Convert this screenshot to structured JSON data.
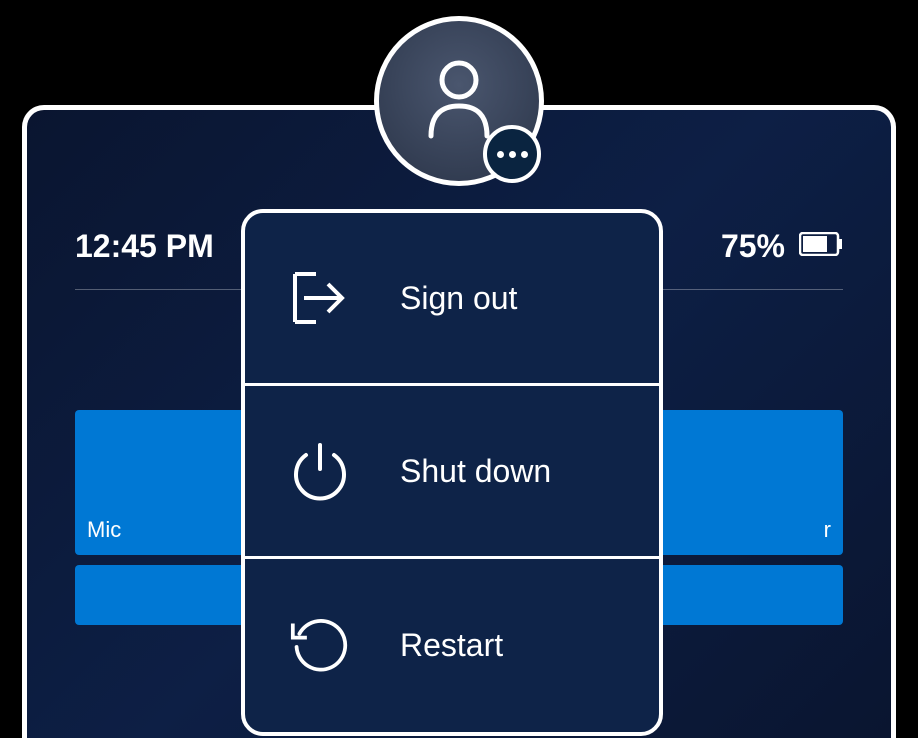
{
  "status": {
    "time": "12:45 PM",
    "battery_percent": "75%"
  },
  "menu": {
    "sign_out_label": "Sign out",
    "shut_down_label": "Shut down",
    "restart_label": "Restart"
  },
  "tiles": {
    "label_left": "Mic",
    "label_right": "r"
  }
}
